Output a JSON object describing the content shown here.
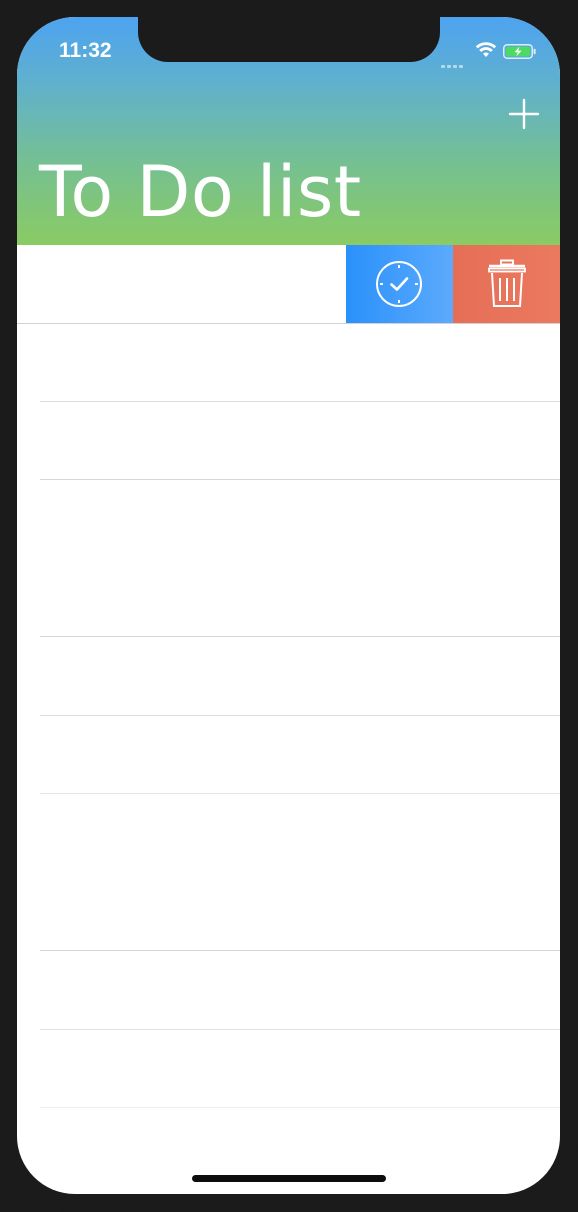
{
  "status_bar": {
    "time": "11:32",
    "icons": [
      "signal-dots-icon",
      "wifi-icon",
      "battery-charging-icon"
    ],
    "battery_color": "#4cd964"
  },
  "header": {
    "title": "To Do list",
    "add_icon": "plus-icon",
    "gradient": [
      "#4da3f0",
      "#8acb63"
    ]
  },
  "swipe_actions": {
    "complete": {
      "icon": "clock-check-icon",
      "color": "#2a91fb"
    },
    "delete": {
      "icon": "trash-icon",
      "color": "#e66e57"
    }
  },
  "list": {
    "rows": [
      {
        "label": ""
      },
      {
        "label": ""
      },
      {
        "label": ""
      },
      {
        "label": ""
      },
      {
        "label": ""
      },
      {
        "label": ""
      },
      {
        "label": ""
      },
      {
        "label": ""
      },
      {
        "label": ""
      }
    ]
  }
}
